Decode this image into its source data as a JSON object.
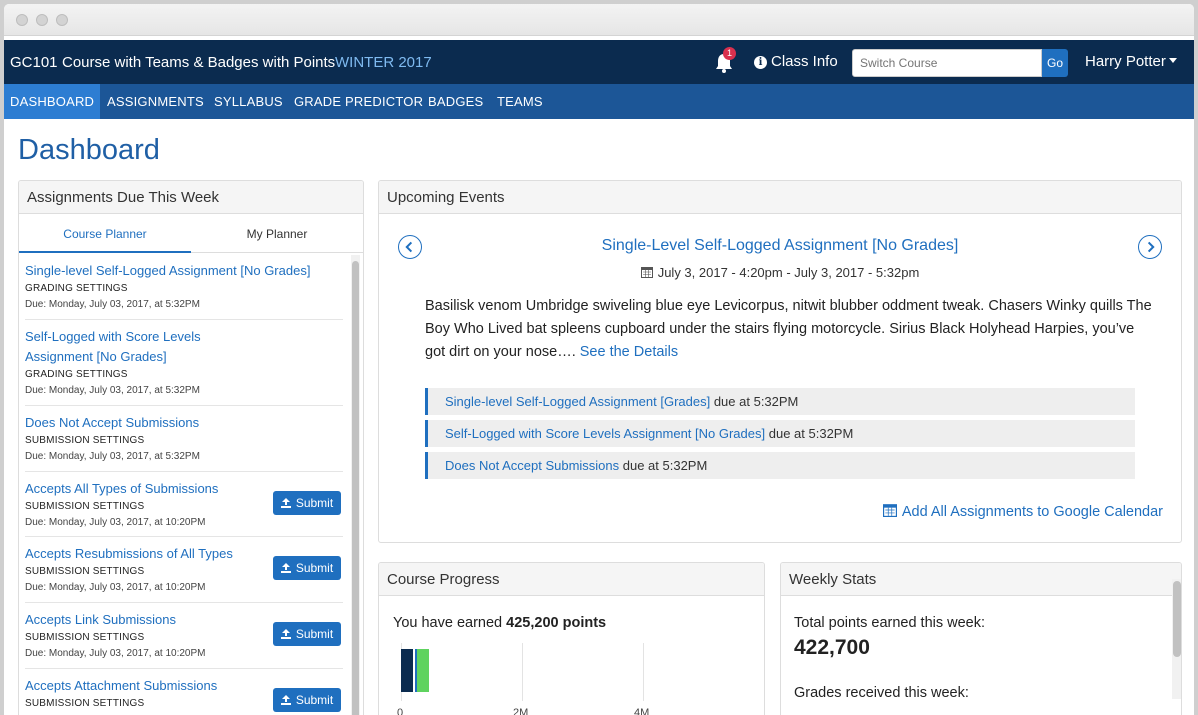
{
  "topbar": {
    "course_code": "GC101",
    "course_name": "Course with Teams & Badges with Points",
    "term": "WINTER 2017",
    "notification_count": "1",
    "class_info": "Class Info",
    "switch_course_placeholder": "Switch Course",
    "go_label": "Go",
    "user_name": "Harry Potter"
  },
  "nav": {
    "items": [
      "DASHBOARD",
      "ASSIGNMENTS",
      "SYLLABUS",
      "GRADE PREDICTOR",
      "BADGES",
      "TEAMS"
    ],
    "active": "DASHBOARD"
  },
  "page": {
    "title": "Dashboard"
  },
  "assignments_panel": {
    "title": "Assignments Due This Week",
    "tabs": [
      "Course Planner",
      "My Planner"
    ],
    "active_tab": "Course Planner",
    "submit_label": "Submit",
    "items": [
      {
        "title": "Single-level Self-Logged Assignment [No Grades]",
        "type": "GRADING SETTINGS",
        "due": "Due: Monday, July 03, 2017, at 5:32PM",
        "has_submit": false
      },
      {
        "title": "Self-Logged with Score Levels Assignment [No Grades]",
        "type": "GRADING SETTINGS",
        "due": "Due: Monday, July 03, 2017, at 5:32PM",
        "has_submit": false
      },
      {
        "title": "Does Not Accept Submissions",
        "type": "SUBMISSION SETTINGS",
        "due": "Due: Monday, July 03, 2017, at 5:32PM",
        "has_submit": false
      },
      {
        "title": "Accepts All Types of Submissions",
        "type": "SUBMISSION SETTINGS",
        "due": "Due: Monday, July 03, 2017, at 10:20PM",
        "has_submit": true
      },
      {
        "title": "Accepts Resubmissions of All Types",
        "type": "SUBMISSION SETTINGS",
        "due": "Due: Monday, July 03, 2017, at 10:20PM",
        "has_submit": true
      },
      {
        "title": "Accepts Link Submissions",
        "type": "SUBMISSION SETTINGS",
        "due": "Due: Monday, July 03, 2017, at 10:20PM",
        "has_submit": true
      },
      {
        "title": "Accepts Attachment Submissions",
        "type": "SUBMISSION SETTINGS",
        "due": "",
        "has_submit": true
      }
    ]
  },
  "events_panel": {
    "title": "Upcoming Events",
    "event_title": "Single-Level Self-Logged Assignment [No Grades]",
    "event_date": "July 3, 2017 - 4:20pm - July 3, 2017 - 5:32pm",
    "description": "Basilisk venom Umbridge swiveling blue eye Levicorpus, nitwit blubber oddment tweak. Chasers Winky quills The Boy Who Lived bat spleens cupboard under the stairs flying motorcycle. Sirius Black Holyhead Harpies, you’ve got dirt on your nose….",
    "details_link": "See the Details",
    "items": [
      {
        "name": "Single-level Self-Logged Assignment [Grades]",
        "due": " due at 5:32PM"
      },
      {
        "name": "Self-Logged with Score Levels Assignment [No Grades]",
        "due": " due at 5:32PM"
      },
      {
        "name": "Does Not Accept Submissions",
        "due": " due at 5:32PM"
      }
    ],
    "google_calendar": "Add All Assignments to Google Calendar"
  },
  "progress_panel": {
    "title": "Course Progress",
    "earned_prefix": "You have earned ",
    "earned_points": "425,200 points",
    "ticks": [
      "0",
      "2M",
      "4M"
    ],
    "bar_segments": [
      {
        "value": 200000,
        "color": "#0b2b4f"
      },
      {
        "value": 225200,
        "color": "#5fd35f"
      }
    ],
    "axis_max": 5000000,
    "colors": {
      "dark": "#0b2b4f",
      "green": "#5fd35f"
    }
  },
  "weekly_panel": {
    "title": "Weekly Stats",
    "points_label": "Total points earned this week:",
    "points_value": "422,700",
    "grades_label": "Grades received this week:"
  },
  "colors": {
    "navy": "#0b2b4f",
    "nav_blue": "#1c5697",
    "active_blue": "#2d7dd2",
    "link_blue": "#1f6fbf"
  }
}
